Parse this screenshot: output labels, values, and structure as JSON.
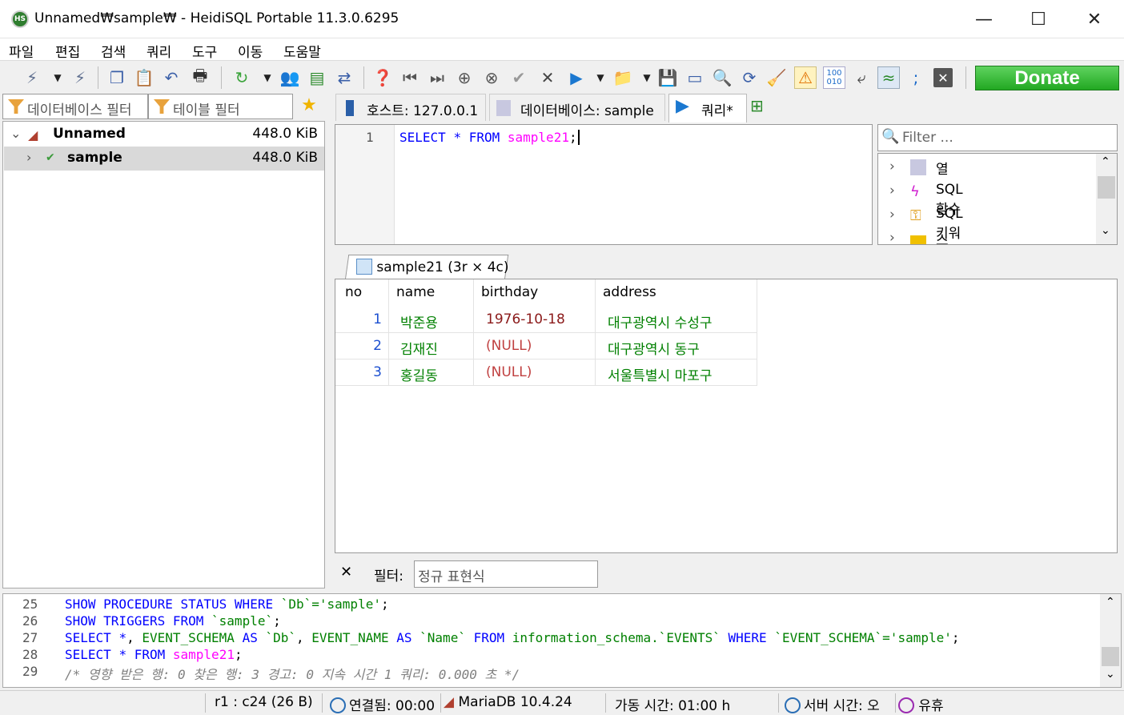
{
  "window": {
    "title": "Unnamed₩sample₩ - HeidiSQL Portable 11.3.0.6295",
    "app_icon_text": "HS",
    "minimize": "—",
    "maximize": "☐",
    "close": "✕"
  },
  "menu": [
    "파일",
    "편집",
    "검색",
    "쿼리",
    "도구",
    "이동",
    "도움말"
  ],
  "toolbar": {
    "donate_label": "Donate"
  },
  "filters": {
    "database_filter": "데이터베이스 필터",
    "table_filter": "테이블 필터"
  },
  "tree": {
    "root": {
      "label": "Unnamed",
      "size": "448.0 KiB"
    },
    "db": {
      "label": "sample",
      "size": "448.0 KiB"
    }
  },
  "tabs": {
    "host": "호스트: 127.0.0.1",
    "database": "데이터베이스: sample",
    "query": "쿼리*"
  },
  "editor": {
    "line_no": "1",
    "kw_select": "SELECT",
    "star": "*",
    "kw_from": "FROM",
    "table": "sample21",
    "semicolon": ";"
  },
  "helper": {
    "filter_placeholder": "Filter ...",
    "items": [
      "열",
      "SQL 함수",
      "SQL 키워드",
      "스니펫"
    ]
  },
  "results": {
    "tab_label": "sample21 (3r × 4c)",
    "columns": [
      "no",
      "name",
      "birthday",
      "address"
    ],
    "rows": [
      [
        "1",
        "박준용",
        "1976-10-18",
        "대구광역시 수성구"
      ],
      [
        "2",
        "김재진",
        "(NULL)",
        "대구광역시 동구"
      ],
      [
        "3",
        "홍길동",
        "(NULL)",
        "서울특별시 마포구"
      ]
    ]
  },
  "grid_filter": {
    "close": "✕",
    "label": "필터:",
    "placeholder": "정규 표현식"
  },
  "log": [
    {
      "no": "25",
      "text": "SHOW PROCEDURE STATUS WHERE `Db`='sample';"
    },
    {
      "no": "26",
      "text": "SHOW TRIGGERS FROM `sample`;"
    },
    {
      "no": "27",
      "text": "SELECT *, EVENT_SCHEMA AS `Db`, EVENT_NAME AS `Name` FROM information_schema.`EVENTS` WHERE `EVENT_SCHEMA`='sample';"
    },
    {
      "no": "28",
      "text": "SELECT * FROM sample21;"
    },
    {
      "no": "29",
      "text": "/* 영향 받은 행: 0  찾은 행: 3  경고: 0  지속 시간 1 쿼리: 0.000 초 */"
    }
  ],
  "status": {
    "cursor": "r1 : c24 (26 B)",
    "connected": "연결됨: 00:00",
    "server": "MariaDB 10.4.24",
    "uptime": "가동 시간: 01:00 h",
    "server_time": "서버 시간: 오",
    "idle": "유휴"
  },
  "colors": {
    "keyword": "#0000ff",
    "table_name": "#ff00ff",
    "string": "#008000",
    "null": "#c04040",
    "donate": "#22a822"
  }
}
